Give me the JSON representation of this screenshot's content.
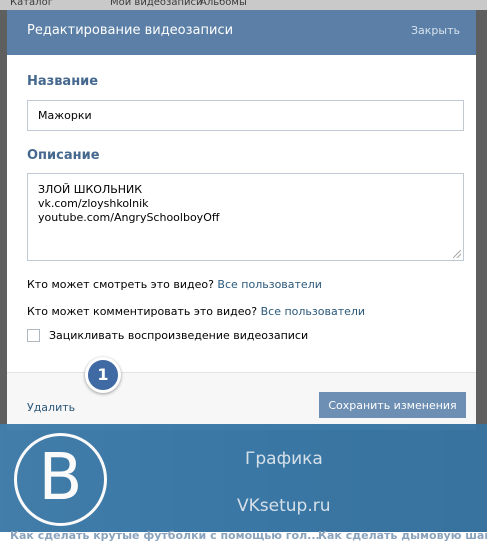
{
  "background": {
    "tabs": [
      "Каталог",
      "Мои видеозаписи",
      "Альбомы"
    ]
  },
  "modal": {
    "title": "Редактирование видеозаписи",
    "close_label": "Закрыть",
    "name_label": "Название",
    "name_value": "Мажорки",
    "description_label": "Описание",
    "description_lines": [
      "ЗЛОЙ ШКОЛЬНИК",
      "vk.com/zloyshkolnik",
      "youtube.com/AngrySchoolboyOff"
    ],
    "view_question": "Кто может смотреть это видео?",
    "view_value": "Все пользователи",
    "comment_question": "Кто может комментировать это видео?",
    "comment_value": "Все пользователи",
    "loop_label": "Зацикливать воспроизведение видеозаписи",
    "loop_checked": false,
    "delete_label": "Удалить",
    "save_label": "Сохранить изменения"
  },
  "annotation": {
    "badge_number": "1"
  },
  "watermark": {
    "logo_letter": "B",
    "line1": "Графика",
    "line2": "VKsetup.ru"
  },
  "bottom_links": [
    "Как сделать крутые футболки с помощью гол...",
    "Как сделать дымовую шаш..."
  ],
  "colors": {
    "header": "#5b7fa6",
    "label": "#45688e",
    "link": "#2b587a",
    "button": "#6d8fb3",
    "band": "#3a79a8"
  }
}
